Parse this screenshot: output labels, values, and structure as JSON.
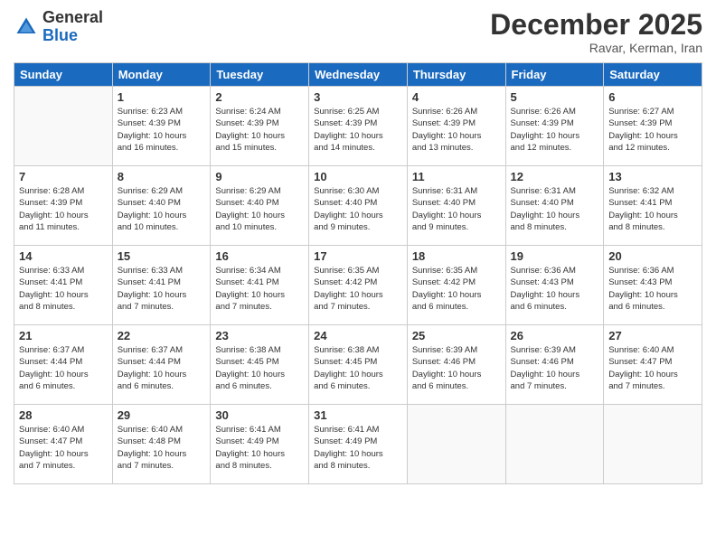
{
  "header": {
    "logo_general": "General",
    "logo_blue": "Blue",
    "month_title": "December 2025",
    "subtitle": "Ravar, Kerman, Iran"
  },
  "days_of_week": [
    "Sunday",
    "Monday",
    "Tuesday",
    "Wednesday",
    "Thursday",
    "Friday",
    "Saturday"
  ],
  "weeks": [
    [
      {
        "day": "",
        "sunrise": "",
        "sunset": "",
        "daylight": ""
      },
      {
        "day": "1",
        "sunrise": "Sunrise: 6:23 AM",
        "sunset": "Sunset: 4:39 PM",
        "daylight": "Daylight: 10 hours and 16 minutes."
      },
      {
        "day": "2",
        "sunrise": "Sunrise: 6:24 AM",
        "sunset": "Sunset: 4:39 PM",
        "daylight": "Daylight: 10 hours and 15 minutes."
      },
      {
        "day": "3",
        "sunrise": "Sunrise: 6:25 AM",
        "sunset": "Sunset: 4:39 PM",
        "daylight": "Daylight: 10 hours and 14 minutes."
      },
      {
        "day": "4",
        "sunrise": "Sunrise: 6:26 AM",
        "sunset": "Sunset: 4:39 PM",
        "daylight": "Daylight: 10 hours and 13 minutes."
      },
      {
        "day": "5",
        "sunrise": "Sunrise: 6:26 AM",
        "sunset": "Sunset: 4:39 PM",
        "daylight": "Daylight: 10 hours and 12 minutes."
      },
      {
        "day": "6",
        "sunrise": "Sunrise: 6:27 AM",
        "sunset": "Sunset: 4:39 PM",
        "daylight": "Daylight: 10 hours and 12 minutes."
      }
    ],
    [
      {
        "day": "7",
        "sunrise": "Sunrise: 6:28 AM",
        "sunset": "Sunset: 4:39 PM",
        "daylight": "Daylight: 10 hours and 11 minutes."
      },
      {
        "day": "8",
        "sunrise": "Sunrise: 6:29 AM",
        "sunset": "Sunset: 4:40 PM",
        "daylight": "Daylight: 10 hours and 10 minutes."
      },
      {
        "day": "9",
        "sunrise": "Sunrise: 6:29 AM",
        "sunset": "Sunset: 4:40 PM",
        "daylight": "Daylight: 10 hours and 10 minutes."
      },
      {
        "day": "10",
        "sunrise": "Sunrise: 6:30 AM",
        "sunset": "Sunset: 4:40 PM",
        "daylight": "Daylight: 10 hours and 9 minutes."
      },
      {
        "day": "11",
        "sunrise": "Sunrise: 6:31 AM",
        "sunset": "Sunset: 4:40 PM",
        "daylight": "Daylight: 10 hours and 9 minutes."
      },
      {
        "day": "12",
        "sunrise": "Sunrise: 6:31 AM",
        "sunset": "Sunset: 4:40 PM",
        "daylight": "Daylight: 10 hours and 8 minutes."
      },
      {
        "day": "13",
        "sunrise": "Sunrise: 6:32 AM",
        "sunset": "Sunset: 4:41 PM",
        "daylight": "Daylight: 10 hours and 8 minutes."
      }
    ],
    [
      {
        "day": "14",
        "sunrise": "Sunrise: 6:33 AM",
        "sunset": "Sunset: 4:41 PM",
        "daylight": "Daylight: 10 hours and 8 minutes."
      },
      {
        "day": "15",
        "sunrise": "Sunrise: 6:33 AM",
        "sunset": "Sunset: 4:41 PM",
        "daylight": "Daylight: 10 hours and 7 minutes."
      },
      {
        "day": "16",
        "sunrise": "Sunrise: 6:34 AM",
        "sunset": "Sunset: 4:41 PM",
        "daylight": "Daylight: 10 hours and 7 minutes."
      },
      {
        "day": "17",
        "sunrise": "Sunrise: 6:35 AM",
        "sunset": "Sunset: 4:42 PM",
        "daylight": "Daylight: 10 hours and 7 minutes."
      },
      {
        "day": "18",
        "sunrise": "Sunrise: 6:35 AM",
        "sunset": "Sunset: 4:42 PM",
        "daylight": "Daylight: 10 hours and 6 minutes."
      },
      {
        "day": "19",
        "sunrise": "Sunrise: 6:36 AM",
        "sunset": "Sunset: 4:43 PM",
        "daylight": "Daylight: 10 hours and 6 minutes."
      },
      {
        "day": "20",
        "sunrise": "Sunrise: 6:36 AM",
        "sunset": "Sunset: 4:43 PM",
        "daylight": "Daylight: 10 hours and 6 minutes."
      }
    ],
    [
      {
        "day": "21",
        "sunrise": "Sunrise: 6:37 AM",
        "sunset": "Sunset: 4:44 PM",
        "daylight": "Daylight: 10 hours and 6 minutes."
      },
      {
        "day": "22",
        "sunrise": "Sunrise: 6:37 AM",
        "sunset": "Sunset: 4:44 PM",
        "daylight": "Daylight: 10 hours and 6 minutes."
      },
      {
        "day": "23",
        "sunrise": "Sunrise: 6:38 AM",
        "sunset": "Sunset: 4:45 PM",
        "daylight": "Daylight: 10 hours and 6 minutes."
      },
      {
        "day": "24",
        "sunrise": "Sunrise: 6:38 AM",
        "sunset": "Sunset: 4:45 PM",
        "daylight": "Daylight: 10 hours and 6 minutes."
      },
      {
        "day": "25",
        "sunrise": "Sunrise: 6:39 AM",
        "sunset": "Sunset: 4:46 PM",
        "daylight": "Daylight: 10 hours and 6 minutes."
      },
      {
        "day": "26",
        "sunrise": "Sunrise: 6:39 AM",
        "sunset": "Sunset: 4:46 PM",
        "daylight": "Daylight: 10 hours and 7 minutes."
      },
      {
        "day": "27",
        "sunrise": "Sunrise: 6:40 AM",
        "sunset": "Sunset: 4:47 PM",
        "daylight": "Daylight: 10 hours and 7 minutes."
      }
    ],
    [
      {
        "day": "28",
        "sunrise": "Sunrise: 6:40 AM",
        "sunset": "Sunset: 4:47 PM",
        "daylight": "Daylight: 10 hours and 7 minutes."
      },
      {
        "day": "29",
        "sunrise": "Sunrise: 6:40 AM",
        "sunset": "Sunset: 4:48 PM",
        "daylight": "Daylight: 10 hours and 7 minutes."
      },
      {
        "day": "30",
        "sunrise": "Sunrise: 6:41 AM",
        "sunset": "Sunset: 4:49 PM",
        "daylight": "Daylight: 10 hours and 8 minutes."
      },
      {
        "day": "31",
        "sunrise": "Sunrise: 6:41 AM",
        "sunset": "Sunset: 4:49 PM",
        "daylight": "Daylight: 10 hours and 8 minutes."
      },
      {
        "day": "",
        "sunrise": "",
        "sunset": "",
        "daylight": ""
      },
      {
        "day": "",
        "sunrise": "",
        "sunset": "",
        "daylight": ""
      },
      {
        "day": "",
        "sunrise": "",
        "sunset": "",
        "daylight": ""
      }
    ]
  ]
}
